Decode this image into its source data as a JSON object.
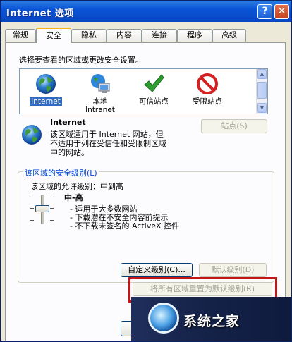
{
  "window": {
    "title": "Internet 选项",
    "help_glyph": "?",
    "close_glyph": "✕"
  },
  "tabs": [
    {
      "label": "常规"
    },
    {
      "label": "安全"
    },
    {
      "label": "隐私"
    },
    {
      "label": "内容"
    },
    {
      "label": "连接"
    },
    {
      "label": "程序"
    },
    {
      "label": "高级"
    }
  ],
  "active_tab": "安全",
  "security": {
    "prompt": "选择要查看的区域或更改安全设置。",
    "zones": [
      {
        "label": "Internet",
        "icon": "globe-icon",
        "selected": true
      },
      {
        "label": "本地\nIntranet",
        "label_line1": "本地",
        "label_line2": "Intranet",
        "icon": "local-intranet-icon"
      },
      {
        "label": "可信站点",
        "icon": "checkmark-icon"
      },
      {
        "label": "受限站点",
        "icon": "restricted-icon"
      }
    ],
    "zone_info": {
      "name": "Internet",
      "desc_line1": "该区域适用于 Internet 网站，但",
      "desc_line2": "不适用于列在受信任和受限制区域",
      "desc_line3": "中的网站。"
    },
    "sites_button": "站点(S)",
    "level_group": {
      "title": "该区域的安全级别(L)",
      "allowed_levels": "该区域的允许级别：中到高",
      "level_name": "中-高",
      "bullets": [
        "- 适用于大多数网站",
        "- 下载潜在不安全内容前提示",
        "- 不下载未签名的 ActiveX 控件"
      ],
      "custom_level_button": "自定义级别(C)...",
      "default_level_button": "默认级别(D)"
    },
    "reset_all_button": "将所有区域重置为默认级别(R)"
  },
  "watermark": {
    "text": "系统之家"
  },
  "colors": {
    "titlebar": "#0a54d6",
    "highlight": "#316ac5",
    "group_title": "#0046d5",
    "annotation_red": "#c31717"
  }
}
